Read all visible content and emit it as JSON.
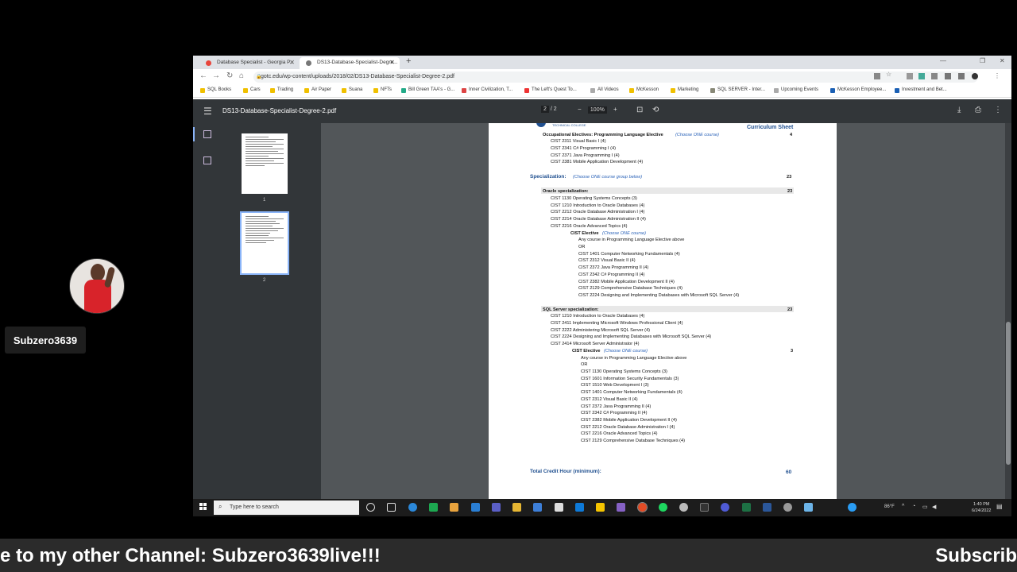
{
  "overlay": {
    "username": "Subzero3639",
    "ticker_left": "e to my other Channel: Subzero3639live!!!",
    "ticker_right": "Subscrib"
  },
  "browser": {
    "tabs": [
      {
        "title": "Database Specialist - Georgia P...",
        "active": false
      },
      {
        "title": "DS13-Database-Specialist-Degre...",
        "active": true
      }
    ],
    "new_tab_icon": "+",
    "url": "gotc.edu/wp-content/uploads/2018/02/DS13-Database-Specialist-Degree-2.pdf",
    "bookmarks": [
      "SQL Books",
      "Cars",
      "Trading",
      "Air Paper",
      "Suana",
      "NFTs",
      "Bill Green TAA's - G...",
      "Inner Civilization, T...",
      "The Left's Quest To...",
      "All Videos",
      "McKesson",
      "Marketing",
      "SQL SERVER - Inter...",
      "Upcoming Events",
      "McKesson Employee...",
      "Investment and Bet..."
    ]
  },
  "pdf": {
    "menu_icon": "☰",
    "filename": "DS13-Database-Specialist-Degree-2.pdf",
    "current_page": "2",
    "total_pages": "/ 2",
    "zoom": "100%",
    "thumb_labels": [
      "1",
      "2"
    ],
    "header_logo_text": "TECHNICAL COLLEGE",
    "header_right": "Curriculum Sheet",
    "content": {
      "occ_heading": "Occupational Electives: Programming Language Elective",
      "occ_choose": "(Choose ONE course)",
      "occ_credits": "4",
      "occ_courses": [
        "CIST 2311 Visual Basic I (4)",
        "CIST 2341 C# Programming I (4)",
        "CIST 2371 Java Programming I (4)",
        "CIST 2381 Mobile Application Development (4)"
      ],
      "spec_heading": "Specialization:",
      "spec_choose": "(Choose ONE course group below)",
      "spec_credits": "23",
      "oracle_heading": "Oracle specialization:",
      "oracle_credits": "23",
      "oracle_courses": [
        "CIST 1130 Operating Systems Concepts (3)",
        "CIST 1210 Introduction to Oracle Databases (4)",
        "CIST 2212 Oracle Database Administration I (4)",
        "CIST 2214 Oracle Database Administration II (4)",
        "CIST 2216 Oracle Advanced Topics (4)"
      ],
      "oracle_elective": "CIST Elective",
      "oracle_elective_choose": "(Choose ONE course)",
      "oracle_elective_courses": [
        "Any course in Programming Language Elective above",
        "OR",
        "CIST 1401 Computer Networking Fundamentals (4)",
        "CIST 2312 Visual Basic II (4)",
        "CIST 2372 Java Programming II (4)",
        "CIST 2342 C# Programming II (4)",
        "CIST 2382 Mobile Application Development II (4)",
        "CIST 2129 Comprehensive Database Techniques (4)",
        "CIST 2224 Designing and Implementing Databases with Microsoft SQL Server (4)"
      ],
      "sql_heading": "SQL Server specialization:",
      "sql_credits": "23",
      "sql_courses": [
        "CIST 1210 Introduction to Oracle Databases (4)",
        "CIST 2411 Implementing Microsoft Windows Professional Client (4)",
        "CIST 2222 Administering Microsoft SQL Server (4)",
        "CIST 2224 Designing and Implementing Databases with Microsoft SQL Server (4)",
        "CIST 2414 Microsoft Server Administrator (4)"
      ],
      "sql_elective": "CIST Elective",
      "sql_elective_choose": "(Choose ONE course)",
      "sql_elective_credits": "3",
      "sql_elective_courses": [
        "Any course in Programming Language Elective above",
        "OR",
        "CIST 1130 Operating Systems Concepts (3)",
        "CIST 1601 Information Security Fundamentals (3)",
        "CIST 1510 Web Development I (3)",
        "CIST 1401 Computer Networking Fundamentals (4)",
        "CIST 2312 Visual Basic II (4)",
        "CIST 2372 Java Programming II (4)",
        "CIST 2342 C# Programming II (4)",
        "CIST 2382 Mobile Application Development II (4)",
        "CIST 2212 Oracle Database Administration I (4)",
        "CIST 2216 Oracle Advanced Topics (4)",
        "CIST 2129 Comprehensive Database Techniques (4)"
      ],
      "total_label": "Total Credit Hour (minimum):",
      "total_value": "60"
    }
  },
  "taskbar": {
    "search_placeholder": "Type here to search",
    "weather": "86°F",
    "time": "1:40 PM",
    "date": "6/24/2022"
  }
}
